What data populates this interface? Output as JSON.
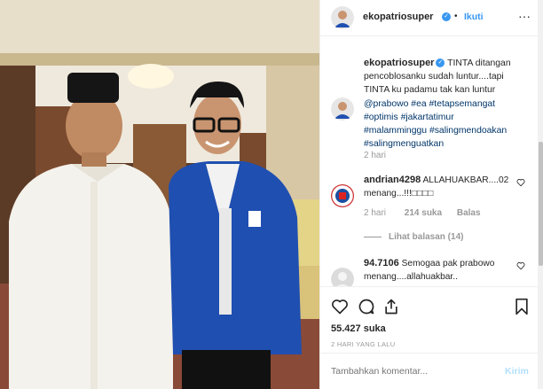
{
  "post": {
    "username": "ekopatriosuper",
    "verified_mark": "✓",
    "separator": "•",
    "follow_label": "Ikuti",
    "more_label": "···"
  },
  "caption": {
    "username": "ekopatriosuper",
    "text": "TINTA ditangan pencoblosanku sudah luntur....tapi TINTA ku padamu tak kan luntur",
    "mention": "@prabowo",
    "hashtags": [
      "#ea",
      "#tetapsemangat",
      "#optimis",
      "#jakartatimur",
      "#malamminggu",
      "#saling­mendoakan",
      "#salingmenguatkan"
    ],
    "time": "2 hari"
  },
  "comments": [
    {
      "username": "andrian4298",
      "text": "ALLAHUAKBAR....02 menang...!!!□□□□",
      "time": "2 hari",
      "likes": "214 suka",
      "reply_label": "Balas",
      "view_replies": "Lihat balasan (14)"
    },
    {
      "username": "94.7106",
      "text": "Semogaa pak prabowo menang....allahuakbar.."
    }
  ],
  "actions": {
    "likes": "55.427 suka",
    "timestamp": "2 HARI YANG LALU"
  },
  "add_comment": {
    "placeholder": "Tambahkan komentar...",
    "submit_label": "Kirim"
  },
  "colors": {
    "accent": "#3897f0",
    "hashtag": "#003569",
    "muted": "#999999",
    "border": "#efefef"
  },
  "icons": [
    "heart-icon",
    "comment-icon",
    "share-icon",
    "bookmark-icon",
    "verified-icon",
    "more-icon"
  ]
}
